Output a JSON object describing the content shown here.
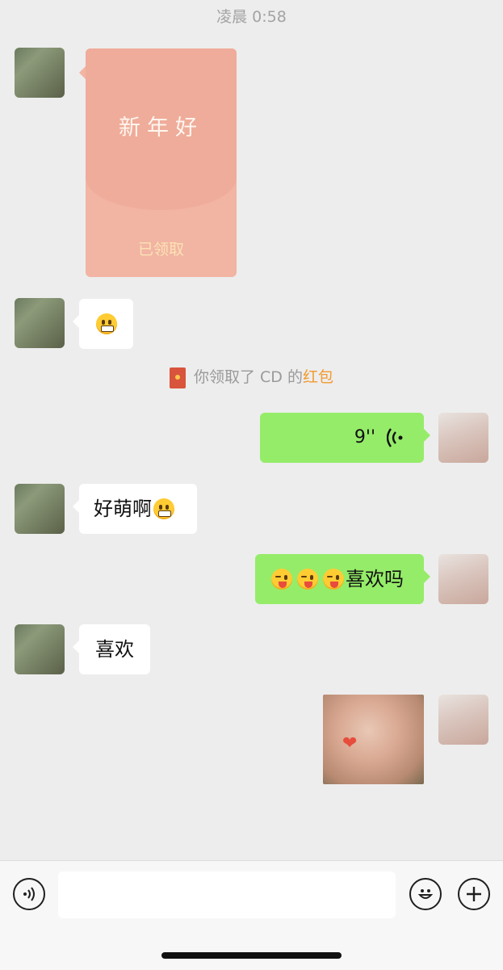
{
  "chat": {
    "timestamp": "凌晨 0:58",
    "red_packet": {
      "title": "新年好",
      "status": "已领取"
    },
    "notice": {
      "prefix": "你领取了 CD 的",
      "link": "红包"
    },
    "messages": {
      "voice_duration": "9''",
      "text_1": "好萌啊",
      "text_2": "喜欢吗",
      "text_3": "喜欢"
    }
  },
  "input_bar": {
    "placeholder": "",
    "voice_icon": "voice-icon",
    "emoji_icon": "emoji-icon",
    "plus_icon": "plus-icon"
  },
  "colors": {
    "background": "#ededed",
    "sent_bubble": "#95ec69",
    "received_bubble": "#ffffff",
    "red_packet": "#f2b4a3",
    "link": "#f29a2e"
  }
}
